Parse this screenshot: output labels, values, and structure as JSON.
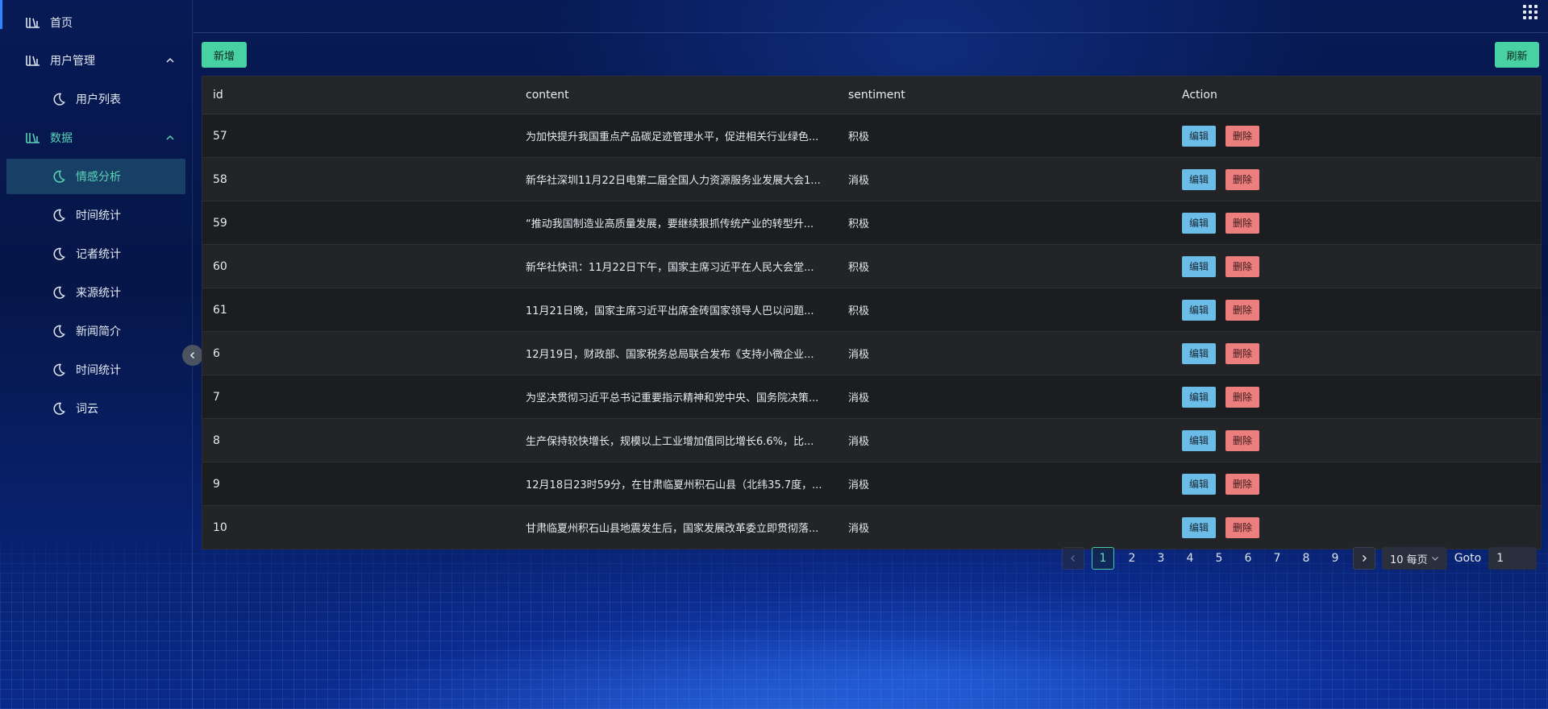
{
  "sidebar": {
    "home": "首页",
    "user_mgmt": "用户管理",
    "user_list": "用户列表",
    "data": "数据",
    "items": [
      "情感分析",
      "时间统计",
      "记者统计",
      "来源统计",
      "新闻简介",
      "时间统计",
      "词云"
    ]
  },
  "toolbar": {
    "add_label": "新增",
    "refresh_label": "刷新"
  },
  "table": {
    "headers": {
      "id": "id",
      "content": "content",
      "sentiment": "sentiment",
      "action": "Action"
    },
    "edit_label": "编辑",
    "delete_label": "删除",
    "rows": [
      {
        "id": "57",
        "content": "为加快提升我国重点产品碳足迹管理水平，促进相关行业绿色...",
        "sentiment": "积极"
      },
      {
        "id": "58",
        "content": "新华社深圳11月22日电第二届全国人力资源服务业发展大会1...",
        "sentiment": "消极"
      },
      {
        "id": "59",
        "content": "“推动我国制造业高质量发展，要继续狠抓传统产业的转型升...",
        "sentiment": "积极"
      },
      {
        "id": "60",
        "content": "新华社快讯：11月22日下午，国家主席习近平在人民大会堂...",
        "sentiment": "积极"
      },
      {
        "id": "61",
        "content": "11月21日晚，国家主席习近平出席金砖国家领导人巴以问题...",
        "sentiment": "积极"
      },
      {
        "id": "6",
        "content": "12月19日，财政部、国家税务总局联合发布《支持小微企业...",
        "sentiment": "消极"
      },
      {
        "id": "7",
        "content": "为坚决贯彻习近平总书记重要指示精神和党中央、国务院决策...",
        "sentiment": "消极"
      },
      {
        "id": "8",
        "content": "生产保持较快增长，规模以上工业增加值同比增长6.6%，比...",
        "sentiment": "消极"
      },
      {
        "id": "9",
        "content": "12月18日23时59分，在甘肃临夏州积石山县（北纬35.7度，...",
        "sentiment": "消极"
      },
      {
        "id": "10",
        "content": "甘肃临夏州积石山县地震发生后，国家发展改革委立即贯彻落...",
        "sentiment": "消极"
      }
    ]
  },
  "pagination": {
    "pages": [
      "1",
      "2",
      "3",
      "4",
      "5",
      "6",
      "7",
      "8",
      "9"
    ],
    "current": "1",
    "page_size": "10 每页",
    "goto_label": "Goto",
    "goto_value": "1"
  },
  "colors": {
    "accent": "#48d2a3",
    "edit": "#6bbde8",
    "delete": "#ec7e7e",
    "active_text": "#5ad2b5"
  }
}
